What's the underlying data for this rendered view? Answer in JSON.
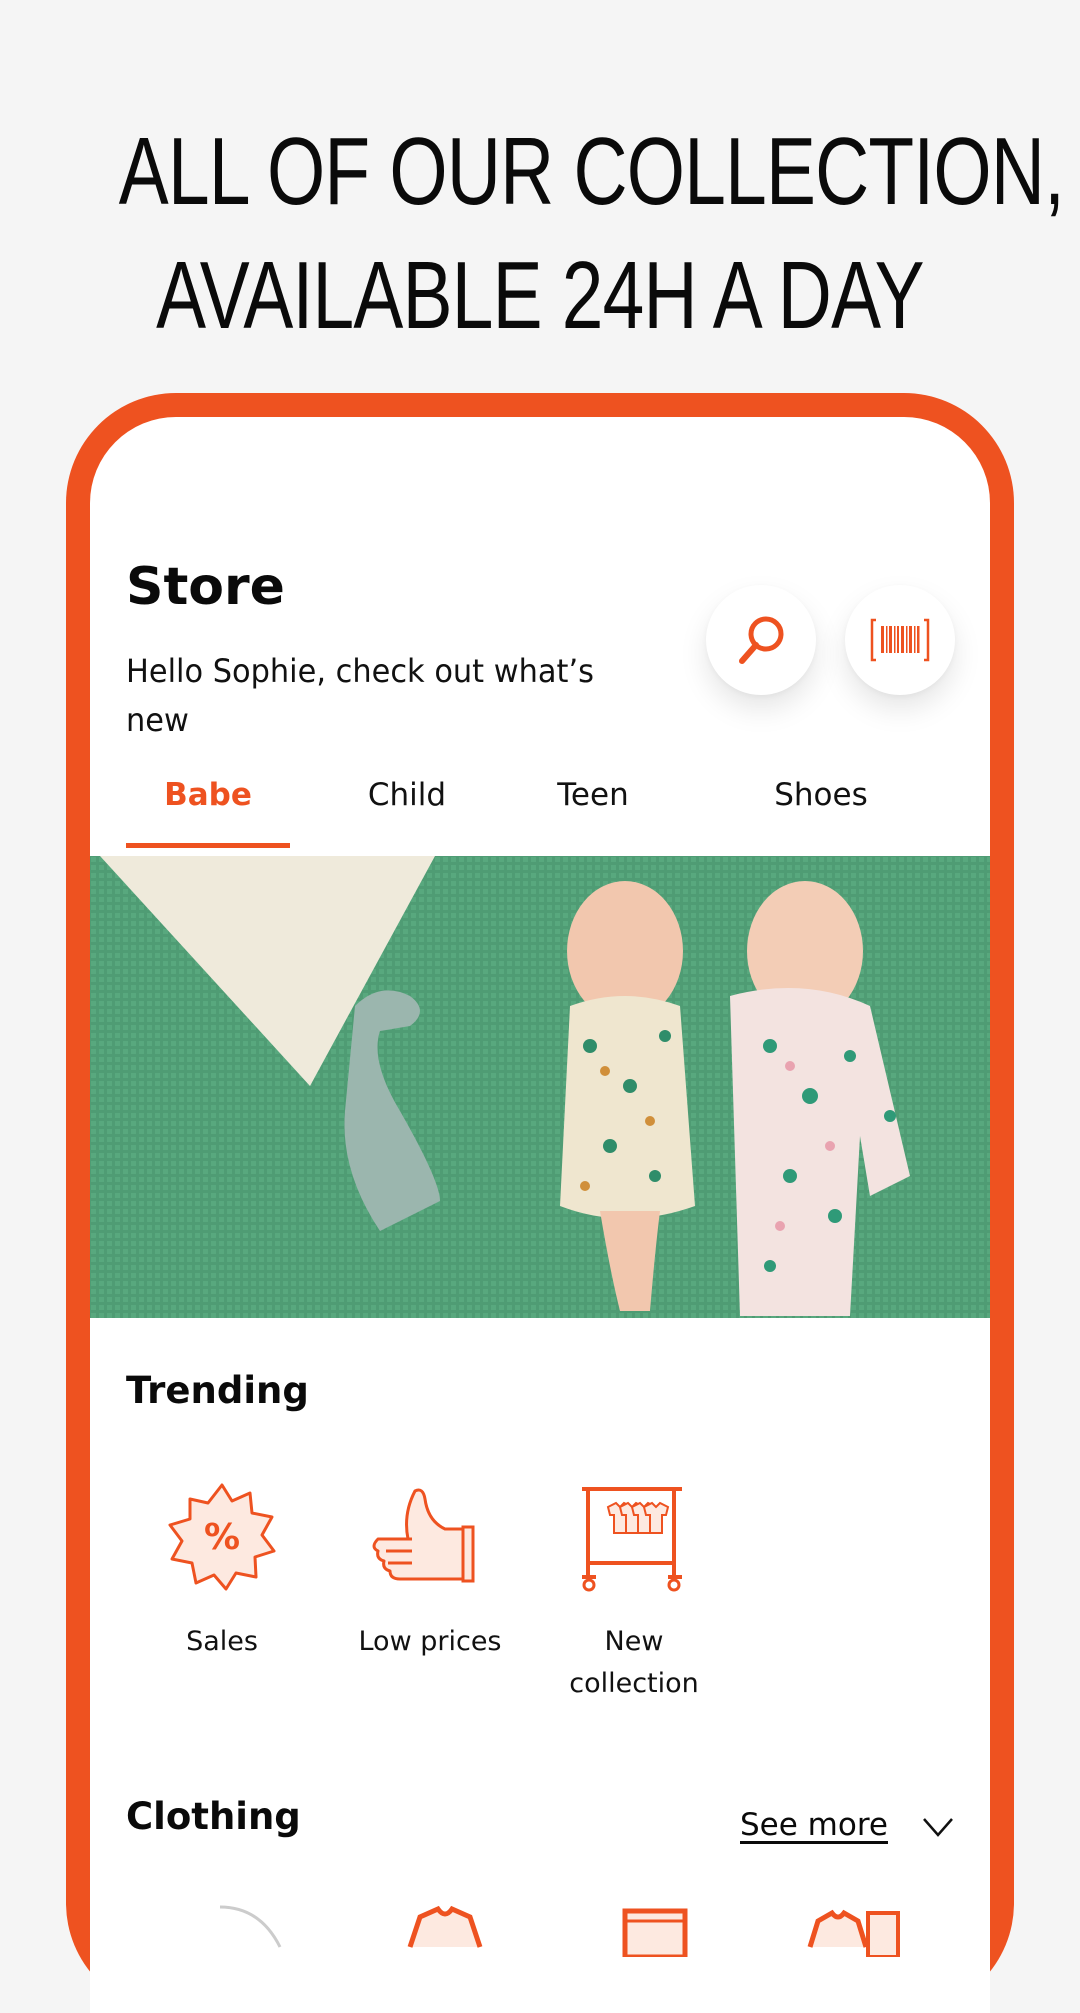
{
  "promo": {
    "headline_line1": "ALL OF OUR COLLECTION,",
    "headline_line2": "AVAILABLE 24H A DAY"
  },
  "colors": {
    "accent": "#ee5220",
    "background": "#f5f5f5",
    "text": "#0a0a0a"
  },
  "header": {
    "title": "Store",
    "greeting": "Hello Sophie, check out what’s new",
    "search_icon": "search-icon",
    "scan_icon": "barcode-scan-icon"
  },
  "tabs": [
    {
      "label": "Babe",
      "active": true
    },
    {
      "label": "Child",
      "active": false
    },
    {
      "label": "Teen",
      "active": false
    },
    {
      "label": "Shoes",
      "active": false
    }
  ],
  "hero": {
    "description": "Two babies in printed outfits lying on a green knit blanket"
  },
  "trending": {
    "title": "Trending",
    "items": [
      {
        "label": "Sales",
        "icon": "percent-badge-icon"
      },
      {
        "label": "Low prices",
        "icon": "thumbs-up-icon"
      },
      {
        "label": "New collection",
        "icon": "clothing-rack-icon"
      }
    ]
  },
  "clothing": {
    "title": "Clothing",
    "see_more": "See more",
    "items": [
      {
        "icon": "bodysuit-icon"
      },
      {
        "icon": "sweater-icon"
      },
      {
        "icon": "shorts-icon"
      },
      {
        "icon": "outfit-set-icon"
      }
    ]
  }
}
